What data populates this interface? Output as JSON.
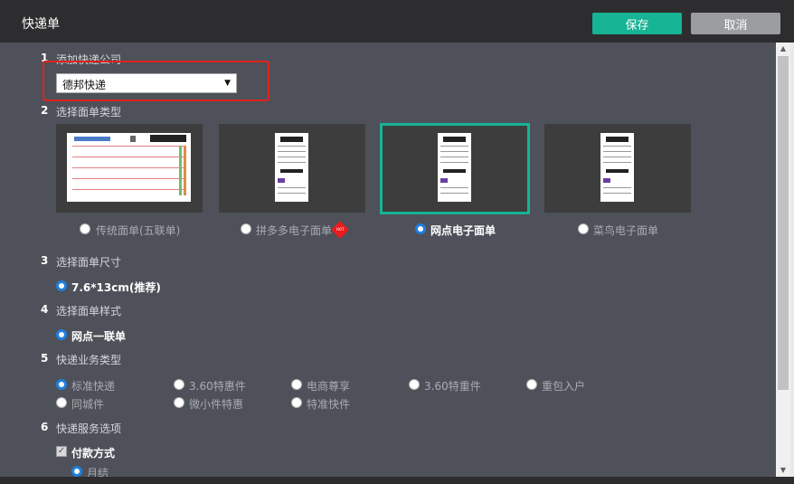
{
  "dialog": {
    "title": "快递单",
    "save_label": "保存",
    "cancel_label": "取消"
  },
  "sections": [
    {
      "num": "1",
      "label": "添加快递公司"
    },
    {
      "num": "2",
      "label": "选择面单类型"
    },
    {
      "num": "3",
      "label": "选择面单尺寸"
    },
    {
      "num": "4",
      "label": "选择面单样式"
    },
    {
      "num": "5",
      "label": "快递业务类型"
    },
    {
      "num": "6",
      "label": "快递服务选项"
    }
  ],
  "company_select": {
    "value": "德邦快递"
  },
  "sheet_types": [
    {
      "label": "传统面单(五联单)",
      "selected": false
    },
    {
      "label": "拼多多电子面单",
      "selected": false,
      "badge": "HOT"
    },
    {
      "label": "网点电子面单",
      "selected": true
    },
    {
      "label": "菜鸟电子面单",
      "selected": false
    }
  ],
  "size": {
    "label": "7.6*13cm(推荐)",
    "selected": true
  },
  "style": {
    "label": "网点一联单",
    "selected": true
  },
  "business_types": [
    {
      "label": "标准快递",
      "selected": true
    },
    {
      "label": "3.60特惠件",
      "selected": false
    },
    {
      "label": "电商尊享",
      "selected": false
    },
    {
      "label": "3.60特重件",
      "selected": false
    },
    {
      "label": "重包入户",
      "selected": false
    },
    {
      "label": "同城件",
      "selected": false
    },
    {
      "label": "微小件特惠",
      "selected": false
    },
    {
      "label": "特准快件",
      "selected": false
    }
  ],
  "service_options": {
    "payment_label": "付款方式",
    "payment_option": "月结"
  },
  "colors": {
    "accent": "#16b394",
    "highlight": "#e0231c",
    "radio_selected": "#1e7fe0"
  }
}
